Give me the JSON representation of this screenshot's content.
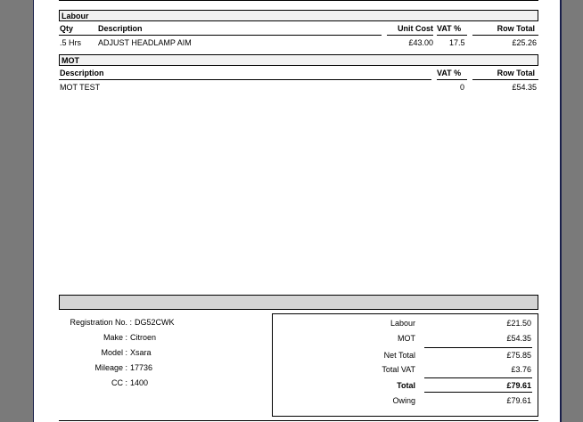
{
  "labour": {
    "section_title": "Labour",
    "headers": {
      "qty": "Qty",
      "description": "Description",
      "unit_cost": "Unit Cost",
      "vat": "VAT %",
      "row_total": "Row Total"
    },
    "rows": [
      {
        "qty": ".5 Hrs",
        "description": "ADJUST HEADLAMP AIM",
        "unit_cost": "£43.00",
        "vat": "17.5",
        "row_total": "£25.26"
      }
    ]
  },
  "mot": {
    "section_title": "MOT",
    "headers": {
      "description": "Description",
      "vat": "VAT %",
      "row_total": "Row Total"
    },
    "rows": [
      {
        "description": "MOT TEST",
        "vat": "0",
        "row_total": "£54.35"
      }
    ]
  },
  "vehicle": {
    "registration_label": "Registration No. :",
    "registration": "DG52CWK",
    "make_label": "Make :",
    "make": "Citroen",
    "model_label": "Model :",
    "model": "Xsara",
    "mileage_label": "Mileage :",
    "mileage": "17736",
    "cc_label": "CC :",
    "cc": "1400"
  },
  "totals": {
    "labour_label": "Labour",
    "labour": "£21.50",
    "mot_label": "MOT",
    "mot": "£54.35",
    "net_label": "Net Total",
    "net": "£75.85",
    "vat_label": "Total VAT",
    "vat": "£3.76",
    "total_label": "Total",
    "total": "£79.61",
    "owing_label": "Owing",
    "owing": "£79.61"
  }
}
